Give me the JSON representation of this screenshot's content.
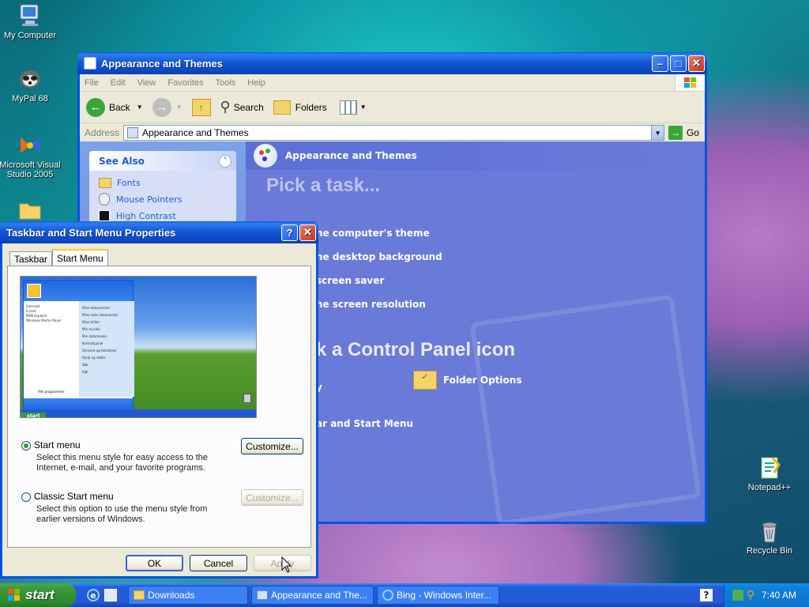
{
  "desktop": {
    "icons": [
      {
        "label": "My Computer"
      },
      {
        "label": "MyPal 68"
      },
      {
        "label": "Microsoft Visual Studio 2005"
      },
      {
        "label": "Notepad++"
      },
      {
        "label": "Recycle Bin"
      }
    ]
  },
  "explorer": {
    "title": "Appearance and Themes",
    "menu": [
      "File",
      "Edit",
      "View",
      "Favorites",
      "Tools",
      "Help"
    ],
    "toolbar": {
      "back": "Back",
      "search": "Search",
      "folders": "Folders"
    },
    "address": {
      "label": "Address",
      "value": "Appearance and Themes",
      "go": "Go"
    },
    "see_also": {
      "title": "See Also",
      "items": [
        "Fonts",
        "Mouse Pointers",
        "High Contrast"
      ]
    },
    "content": {
      "header": "Appearance and Themes",
      "pick_task": "Pick a task...",
      "tasks": [
        "he computer's theme",
        "he desktop background",
        " screen saver",
        "he screen resolution"
      ],
      "pick_icon": "k a Control Panel icon",
      "icons": [
        "y",
        "Folder Options",
        "ar and Start Menu"
      ]
    }
  },
  "dialog": {
    "title": "Taskbar and Start Menu Properties",
    "tabs": [
      "Taskbar",
      "Start Menu"
    ],
    "preview": {
      "start_label": "start",
      "all_programs": "Alle programmer",
      "left_items": [
        "Internett",
        "E-post",
        "MSN Explorer",
        "Windows Media Player"
      ],
      "right_items": [
        "Mine dokumenter",
        "Mine siste dokumenter",
        "Mine bilder",
        "Min musikk",
        "Min datamaskin",
        "Kontrollpanel",
        "Skrivere og telefakser",
        "Hjelp og støtte",
        "Søk",
        "Kjør"
      ]
    },
    "option1": {
      "label": "Start menu",
      "desc": "Select this menu style for easy access to the Internet, e-mail, and your favorite programs.",
      "button": "Customize..."
    },
    "option2": {
      "label": "Classic Start menu",
      "desc": "Select this option to use the menu style from earlier versions of Windows.",
      "button": "Customize..."
    },
    "buttons": {
      "ok": "OK",
      "cancel": "Cancel",
      "apply": "Apply"
    }
  },
  "taskbar": {
    "start": "start",
    "items": [
      "Downloads",
      "Appearance and The...",
      "Bing - Windows Inter..."
    ],
    "clock": "7:40 AM"
  }
}
